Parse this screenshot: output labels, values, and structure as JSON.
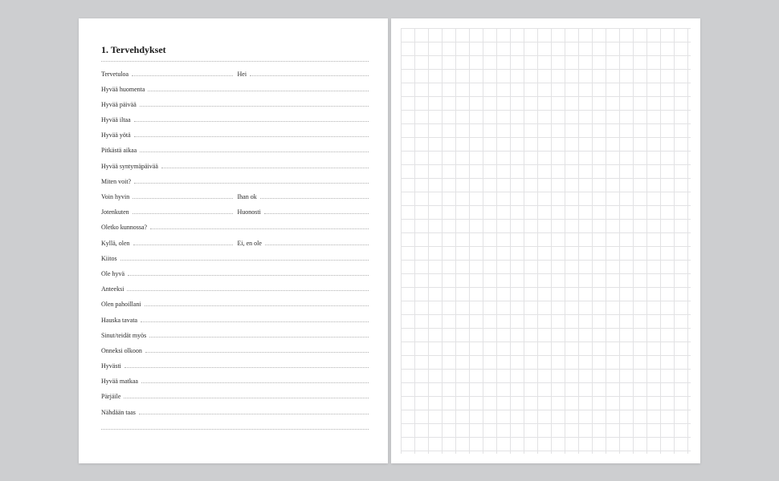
{
  "heading": "1. Tervehdykset",
  "rows": [
    {
      "left": "Tervetuloa",
      "right": "Hei"
    },
    {
      "left": "Hyvää huomenta",
      "right": null
    },
    {
      "left": "Hyvää päivää",
      "right": null
    },
    {
      "left": "Hyvää iltaa",
      "right": null
    },
    {
      "left": "Hyvää yötä",
      "right": null
    },
    {
      "left": "Pitkästä aikaa",
      "right": null
    },
    {
      "left": "Hyvää syntymäpäivää",
      "right": null
    },
    {
      "left": "Miten voit?",
      "right": null
    },
    {
      "left": "Voin hyvin",
      "right": "Ihan ok"
    },
    {
      "left": "Jotenkuten",
      "right": "Huonosti"
    },
    {
      "left": "Oletko kunnossa?",
      "right": null
    },
    {
      "left": "Kyllä, olen",
      "right": "Ei, en ole"
    },
    {
      "left": "Kiitos",
      "right": null
    },
    {
      "left": "Ole hyvä",
      "right": null
    },
    {
      "left": "Anteeksi",
      "right": null
    },
    {
      "left": "Olen pahoillani",
      "right": null
    },
    {
      "left": "Hauska tavata",
      "right": null
    },
    {
      "left": "Sinut/teidät myös",
      "right": null
    },
    {
      "left": "Onneksi olkoon",
      "right": null
    },
    {
      "left": "Hyvästi",
      "right": null
    },
    {
      "left": "Hyvää matkaa",
      "right": null
    },
    {
      "left": "Pärjäile",
      "right": null
    },
    {
      "left": "Nähdään taas",
      "right": null
    },
    {
      "left": "",
      "right": null
    }
  ]
}
